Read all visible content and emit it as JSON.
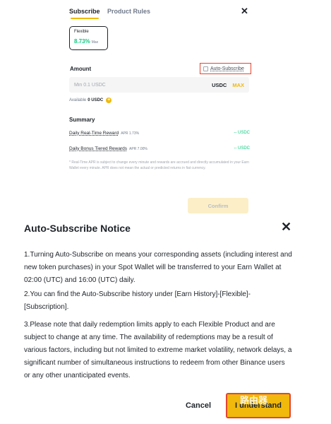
{
  "tabs": {
    "subscribe": "Subscribe",
    "product_rules": "Product Rules"
  },
  "close_top": "✕",
  "term_card": {
    "label": "Flexible",
    "apr": "8.73%",
    "max": "Max"
  },
  "amount": {
    "label": "Amount",
    "auto_subscribe": "Auto-Subscribe",
    "placeholder": "Min 0.1 USDC",
    "currency": "USDC",
    "max_label": "MAX",
    "available_label": "Available",
    "available_value": "0 USDC",
    "add_icon": "+"
  },
  "summary": {
    "title": "Summary",
    "rows": [
      {
        "label": "Daily Real-Time Reward",
        "apr": "APR 1.73%",
        "value": "-- USDC"
      },
      {
        "label": "Daily Bonus Tiered Rewards",
        "apr": "APR 7.00%",
        "value": "-- USDC"
      }
    ],
    "note": "* Real-Time APR is subject to change every minute and rewards are accrued and directly accumulated in your Earn Wallet every minute. APR does not mean the actual or predicted returns in fiat currency."
  },
  "confirm_label": "Confirm",
  "modal": {
    "title": "Auto-Subscribe Notice",
    "close": "✕",
    "items": [
      "1.Turning Auto-Subscribe on means your corresponding assets (including interest and new token purchases) in your Spot Wallet will be transferred to your Earn Wallet at 02:00 (UTC) and 16:00 (UTC) daily.",
      "2.You can find the Auto-Subscribe history under [Earn History]-[Flexible]-[Subscription].",
      "3.Please note that daily redemption limits apply to each Flexible Product and are subject to change at any time. The availability of redemptions may be a result of various factors, including but not limited to extreme market volatility, network delays, a significant number of simultaneous instructions to redeem from other Binance users or any other unanticipated events."
    ],
    "cancel": "Cancel",
    "understand": "I understand"
  },
  "watermark": "路由器"
}
